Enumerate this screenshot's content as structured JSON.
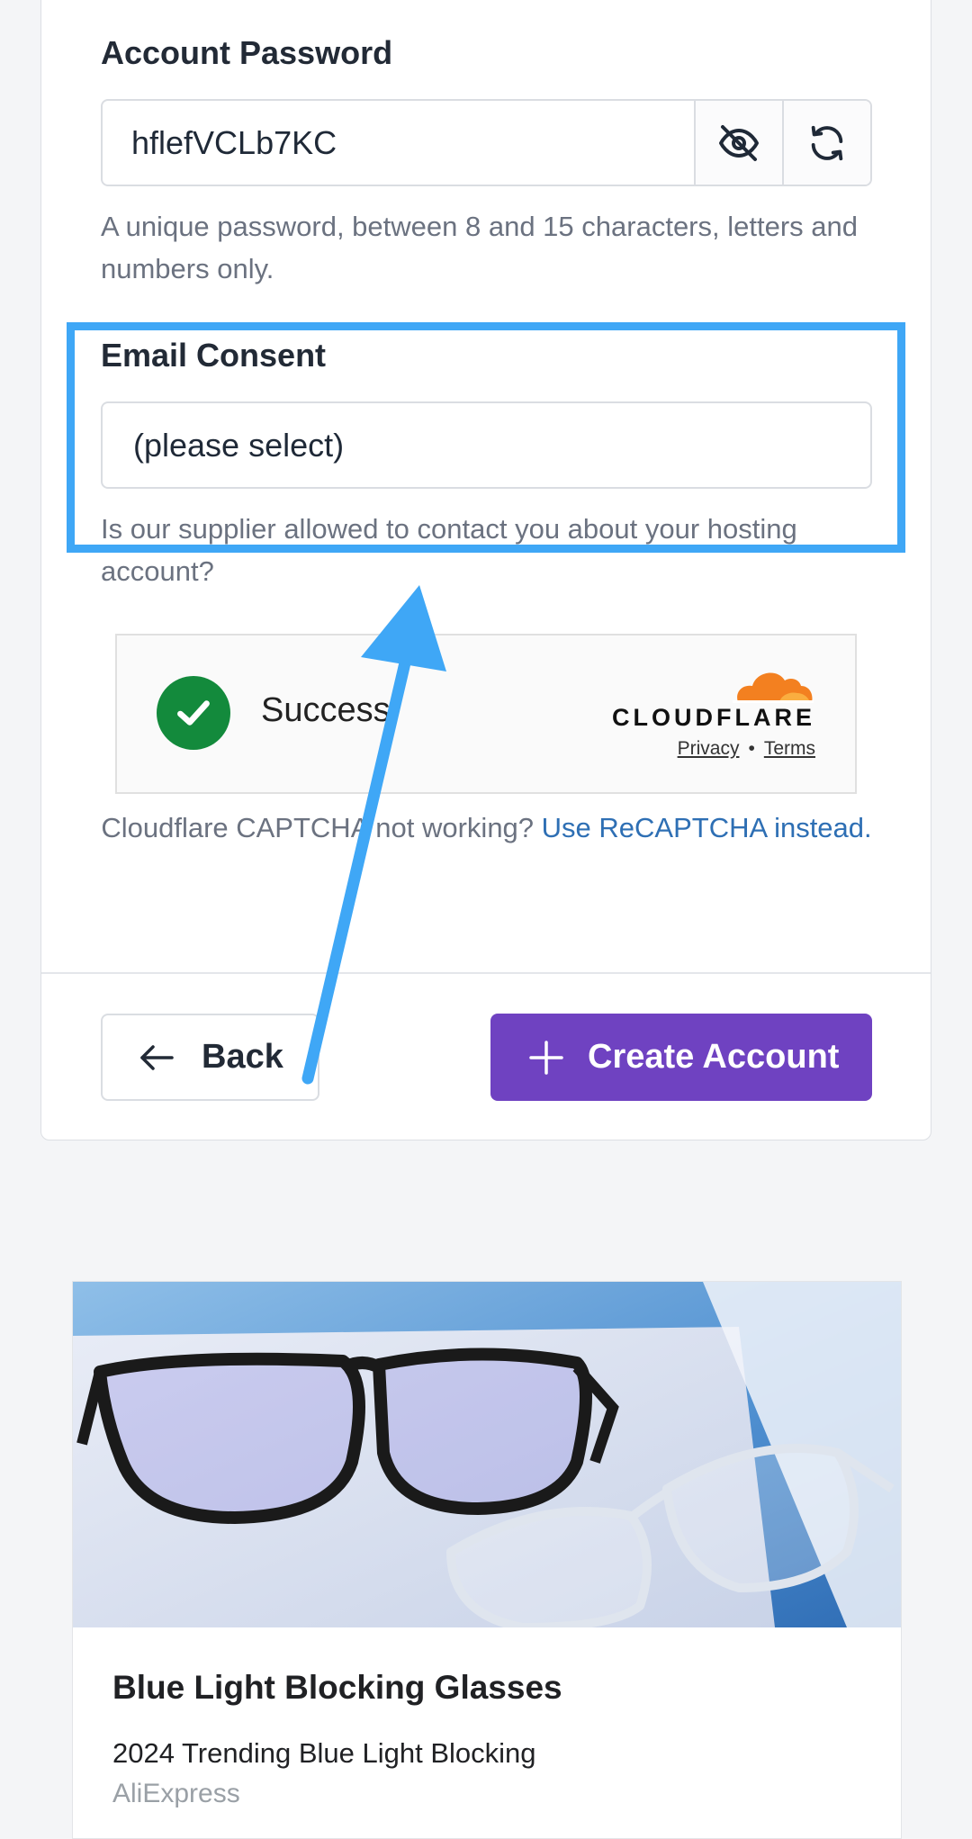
{
  "form": {
    "password": {
      "label": "Account Password",
      "value": "hflefVCLb7KC",
      "help": "A unique password, between 8 and 15 characters, letters and numbers only.",
      "toggle_icon": "eye-off-icon",
      "regenerate_icon": "refresh-icon"
    },
    "email_consent": {
      "label": "Email Consent",
      "selected": "(please select)",
      "help": "Is our supplier allowed to contact you about your hosting account?"
    },
    "captcha": {
      "status": "Success!",
      "provider": "CLOUDFLARE",
      "privacy": "Privacy",
      "separator": "•",
      "terms": "Terms",
      "alt_text": "Cloudflare CAPTCHA not working?",
      "alt_link": "Use ReCAPTCHA instead."
    },
    "actions": {
      "back": "Back",
      "create": "Create Account"
    }
  },
  "ad": {
    "title": "Blue Light Blocking Glasses",
    "description": "2024 Trending Blue Light Blocking",
    "source": "AliExpress"
  },
  "colors": {
    "primary": "#6f42c1",
    "highlight": "#3fa7f6",
    "success": "#138a3c",
    "link": "#2e6fb4"
  }
}
